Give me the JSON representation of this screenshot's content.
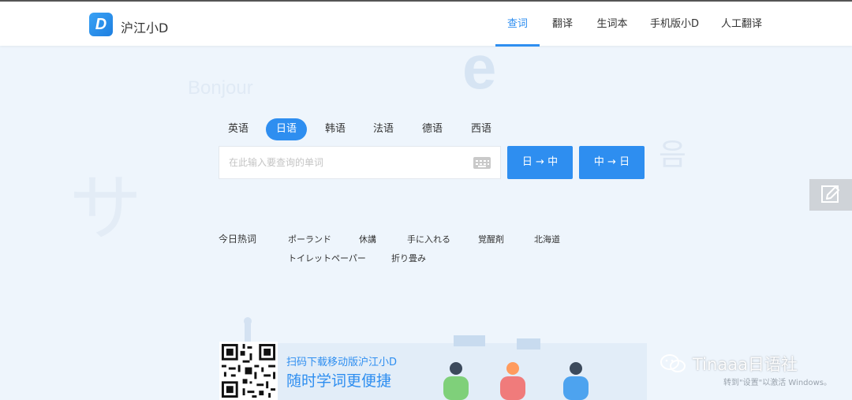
{
  "header": {
    "logo_letter": "D",
    "brand": "沪江小D",
    "nav": [
      {
        "label": "查词",
        "active": true
      },
      {
        "label": "翻译",
        "active": false
      },
      {
        "label": "生词本",
        "active": false
      },
      {
        "label": "手机版小D",
        "active": false
      },
      {
        "label": "人工翻译",
        "active": false
      }
    ]
  },
  "background_text": {
    "e": "e",
    "bonjour": "Bonjour",
    "sa": "サ",
    "eum": "음"
  },
  "languages": [
    {
      "label": "英语",
      "active": false
    },
    {
      "label": "日语",
      "active": true
    },
    {
      "label": "韩语",
      "active": false
    },
    {
      "label": "法语",
      "active": false
    },
    {
      "label": "德语",
      "active": false
    },
    {
      "label": "西语",
      "active": false
    }
  ],
  "search": {
    "placeholder": "在此输入要查询的单词",
    "value": "",
    "buttons": [
      "日 → 中",
      "中 → 日"
    ]
  },
  "hot": {
    "title": "今日热词",
    "words": [
      "ポーランド",
      "休講",
      "手に入れる",
      "覚醒剤",
      "北海道",
      "トイレットペーパー",
      "折り畳み"
    ]
  },
  "promo": {
    "line1": "扫码下载移动版沪江小D",
    "line2": "随时学词更便捷"
  },
  "overlay": {
    "watermark": "Tinaaa日语社",
    "activate_windows": "转到\"设置\"以激活 Windows。"
  },
  "colors": {
    "accent": "#2e8ef0",
    "background": "#eef5fc"
  }
}
